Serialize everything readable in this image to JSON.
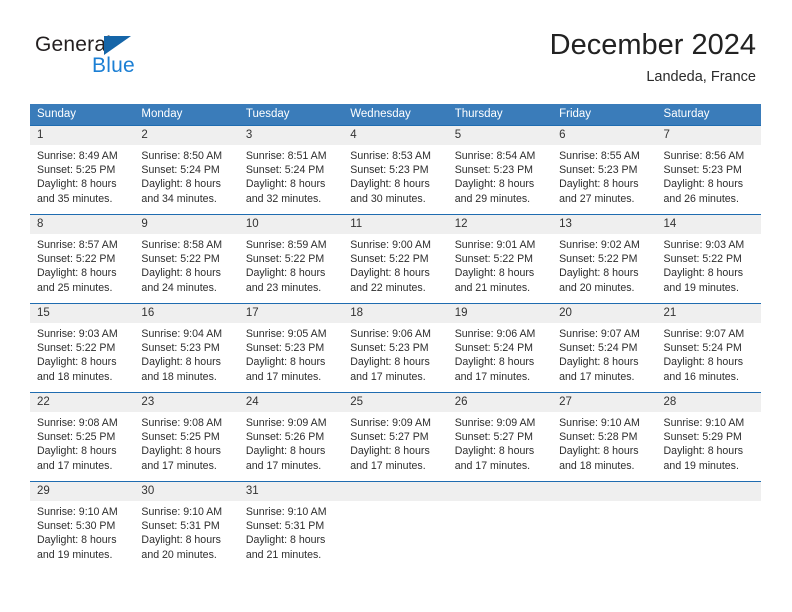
{
  "brand": {
    "name_part1": "General",
    "name_part2": "Blue",
    "triangle_color": "#1565a8",
    "blue_color": "#1b7fd4"
  },
  "header": {
    "title": "December 2024",
    "subtitle": "Landeda, France"
  },
  "theme": {
    "header_blue": "#3a7cba",
    "row_border_blue": "#1f6cb0",
    "day_band_gray": "#efefef"
  },
  "weekdays": [
    "Sunday",
    "Monday",
    "Tuesday",
    "Wednesday",
    "Thursday",
    "Friday",
    "Saturday"
  ],
  "weeks": [
    [
      {
        "day": "1",
        "sunrise": "Sunrise: 8:49 AM",
        "sunset": "Sunset: 5:25 PM",
        "daylight1": "Daylight: 8 hours",
        "daylight2": "and 35 minutes."
      },
      {
        "day": "2",
        "sunrise": "Sunrise: 8:50 AM",
        "sunset": "Sunset: 5:24 PM",
        "daylight1": "Daylight: 8 hours",
        "daylight2": "and 34 minutes."
      },
      {
        "day": "3",
        "sunrise": "Sunrise: 8:51 AM",
        "sunset": "Sunset: 5:24 PM",
        "daylight1": "Daylight: 8 hours",
        "daylight2": "and 32 minutes."
      },
      {
        "day": "4",
        "sunrise": "Sunrise: 8:53 AM",
        "sunset": "Sunset: 5:23 PM",
        "daylight1": "Daylight: 8 hours",
        "daylight2": "and 30 minutes."
      },
      {
        "day": "5",
        "sunrise": "Sunrise: 8:54 AM",
        "sunset": "Sunset: 5:23 PM",
        "daylight1": "Daylight: 8 hours",
        "daylight2": "and 29 minutes."
      },
      {
        "day": "6",
        "sunrise": "Sunrise: 8:55 AM",
        "sunset": "Sunset: 5:23 PM",
        "daylight1": "Daylight: 8 hours",
        "daylight2": "and 27 minutes."
      },
      {
        "day": "7",
        "sunrise": "Sunrise: 8:56 AM",
        "sunset": "Sunset: 5:23 PM",
        "daylight1": "Daylight: 8 hours",
        "daylight2": "and 26 minutes."
      }
    ],
    [
      {
        "day": "8",
        "sunrise": "Sunrise: 8:57 AM",
        "sunset": "Sunset: 5:22 PM",
        "daylight1": "Daylight: 8 hours",
        "daylight2": "and 25 minutes."
      },
      {
        "day": "9",
        "sunrise": "Sunrise: 8:58 AM",
        "sunset": "Sunset: 5:22 PM",
        "daylight1": "Daylight: 8 hours",
        "daylight2": "and 24 minutes."
      },
      {
        "day": "10",
        "sunrise": "Sunrise: 8:59 AM",
        "sunset": "Sunset: 5:22 PM",
        "daylight1": "Daylight: 8 hours",
        "daylight2": "and 23 minutes."
      },
      {
        "day": "11",
        "sunrise": "Sunrise: 9:00 AM",
        "sunset": "Sunset: 5:22 PM",
        "daylight1": "Daylight: 8 hours",
        "daylight2": "and 22 minutes."
      },
      {
        "day": "12",
        "sunrise": "Sunrise: 9:01 AM",
        "sunset": "Sunset: 5:22 PM",
        "daylight1": "Daylight: 8 hours",
        "daylight2": "and 21 minutes."
      },
      {
        "day": "13",
        "sunrise": "Sunrise: 9:02 AM",
        "sunset": "Sunset: 5:22 PM",
        "daylight1": "Daylight: 8 hours",
        "daylight2": "and 20 minutes."
      },
      {
        "day": "14",
        "sunrise": "Sunrise: 9:03 AM",
        "sunset": "Sunset: 5:22 PM",
        "daylight1": "Daylight: 8 hours",
        "daylight2": "and 19 minutes."
      }
    ],
    [
      {
        "day": "15",
        "sunrise": "Sunrise: 9:03 AM",
        "sunset": "Sunset: 5:22 PM",
        "daylight1": "Daylight: 8 hours",
        "daylight2": "and 18 minutes."
      },
      {
        "day": "16",
        "sunrise": "Sunrise: 9:04 AM",
        "sunset": "Sunset: 5:23 PM",
        "daylight1": "Daylight: 8 hours",
        "daylight2": "and 18 minutes."
      },
      {
        "day": "17",
        "sunrise": "Sunrise: 9:05 AM",
        "sunset": "Sunset: 5:23 PM",
        "daylight1": "Daylight: 8 hours",
        "daylight2": "and 17 minutes."
      },
      {
        "day": "18",
        "sunrise": "Sunrise: 9:06 AM",
        "sunset": "Sunset: 5:23 PM",
        "daylight1": "Daylight: 8 hours",
        "daylight2": "and 17 minutes."
      },
      {
        "day": "19",
        "sunrise": "Sunrise: 9:06 AM",
        "sunset": "Sunset: 5:24 PM",
        "daylight1": "Daylight: 8 hours",
        "daylight2": "and 17 minutes."
      },
      {
        "day": "20",
        "sunrise": "Sunrise: 9:07 AM",
        "sunset": "Sunset: 5:24 PM",
        "daylight1": "Daylight: 8 hours",
        "daylight2": "and 17 minutes."
      },
      {
        "day": "21",
        "sunrise": "Sunrise: 9:07 AM",
        "sunset": "Sunset: 5:24 PM",
        "daylight1": "Daylight: 8 hours",
        "daylight2": "and 16 minutes."
      }
    ],
    [
      {
        "day": "22",
        "sunrise": "Sunrise: 9:08 AM",
        "sunset": "Sunset: 5:25 PM",
        "daylight1": "Daylight: 8 hours",
        "daylight2": "and 17 minutes."
      },
      {
        "day": "23",
        "sunrise": "Sunrise: 9:08 AM",
        "sunset": "Sunset: 5:25 PM",
        "daylight1": "Daylight: 8 hours",
        "daylight2": "and 17 minutes."
      },
      {
        "day": "24",
        "sunrise": "Sunrise: 9:09 AM",
        "sunset": "Sunset: 5:26 PM",
        "daylight1": "Daylight: 8 hours",
        "daylight2": "and 17 minutes."
      },
      {
        "day": "25",
        "sunrise": "Sunrise: 9:09 AM",
        "sunset": "Sunset: 5:27 PM",
        "daylight1": "Daylight: 8 hours",
        "daylight2": "and 17 minutes."
      },
      {
        "day": "26",
        "sunrise": "Sunrise: 9:09 AM",
        "sunset": "Sunset: 5:27 PM",
        "daylight1": "Daylight: 8 hours",
        "daylight2": "and 17 minutes."
      },
      {
        "day": "27",
        "sunrise": "Sunrise: 9:10 AM",
        "sunset": "Sunset: 5:28 PM",
        "daylight1": "Daylight: 8 hours",
        "daylight2": "and 18 minutes."
      },
      {
        "day": "28",
        "sunrise": "Sunrise: 9:10 AM",
        "sunset": "Sunset: 5:29 PM",
        "daylight1": "Daylight: 8 hours",
        "daylight2": "and 19 minutes."
      }
    ],
    [
      {
        "day": "29",
        "sunrise": "Sunrise: 9:10 AM",
        "sunset": "Sunset: 5:30 PM",
        "daylight1": "Daylight: 8 hours",
        "daylight2": "and 19 minutes."
      },
      {
        "day": "30",
        "sunrise": "Sunrise: 9:10 AM",
        "sunset": "Sunset: 5:31 PM",
        "daylight1": "Daylight: 8 hours",
        "daylight2": "and 20 minutes."
      },
      {
        "day": "31",
        "sunrise": "Sunrise: 9:10 AM",
        "sunset": "Sunset: 5:31 PM",
        "daylight1": "Daylight: 8 hours",
        "daylight2": "and 21 minutes."
      },
      {
        "day": "",
        "sunrise": "",
        "sunset": "",
        "daylight1": "",
        "daylight2": ""
      },
      {
        "day": "",
        "sunrise": "",
        "sunset": "",
        "daylight1": "",
        "daylight2": ""
      },
      {
        "day": "",
        "sunrise": "",
        "sunset": "",
        "daylight1": "",
        "daylight2": ""
      },
      {
        "day": "",
        "sunrise": "",
        "sunset": "",
        "daylight1": "",
        "daylight2": ""
      }
    ]
  ]
}
